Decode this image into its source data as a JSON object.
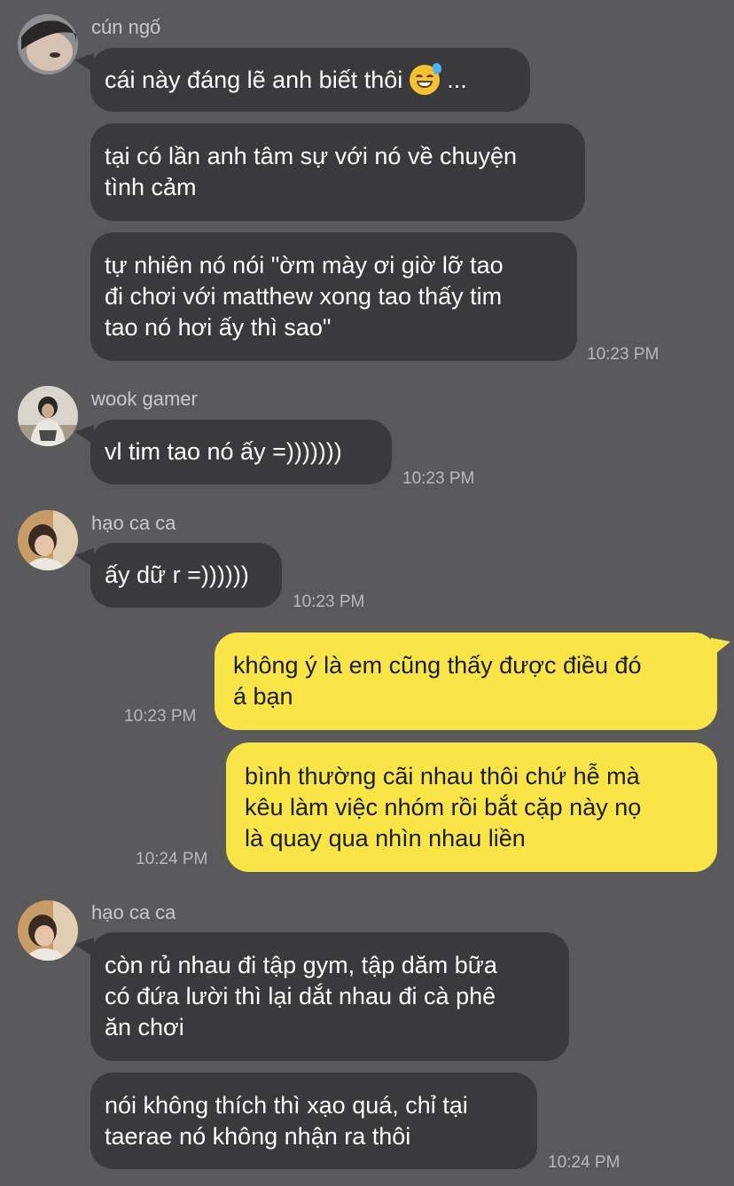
{
  "messages": [
    {
      "sender": "cún ngố",
      "lines": [
        "cái này đáng lẽ anh biết thôi",
        "...",
        "tại có lần anh tâm sự với nó về chuyện\ntình cảm",
        "tự nhiên nó nói \"ờm mày ơi giờ lỡ tao\nđi chơi với matthew xong tao thấy tim\ntao nó hơi ấy thì sao\""
      ],
      "time": "10:23 PM"
    },
    {
      "sender": "wook gamer",
      "lines": [
        "vl tim tao nó ấy =)))))))"
      ],
      "time": "10:23 PM"
    },
    {
      "sender": "hạo ca ca",
      "lines": [
        "ấy dữ r =))))))"
      ],
      "time": "10:23 PM"
    },
    {
      "sender": "me",
      "lines": [
        "không ý là em cũng thấy được điều đó\ná bạn"
      ],
      "time": "10:23 PM"
    },
    {
      "sender": "me",
      "lines": [
        "bình thường cãi nhau thôi chứ hễ mà\nkêu làm việc nhóm rồi bắt cặp này nọ\nlà quay qua nhìn nhau liền"
      ],
      "time": "10:24 PM"
    },
    {
      "sender": "hạo ca ca",
      "lines": [
        "còn rủ nhau đi tập gym, tập dăm bữa\ncó đứa lười thì lại dắt nhau đi cà phê\năn chơi",
        "nói không thích thì xạo quá, chỉ tại\ntaerae nó không nhận ra thôi"
      ],
      "time": "10:24 PM"
    }
  ]
}
